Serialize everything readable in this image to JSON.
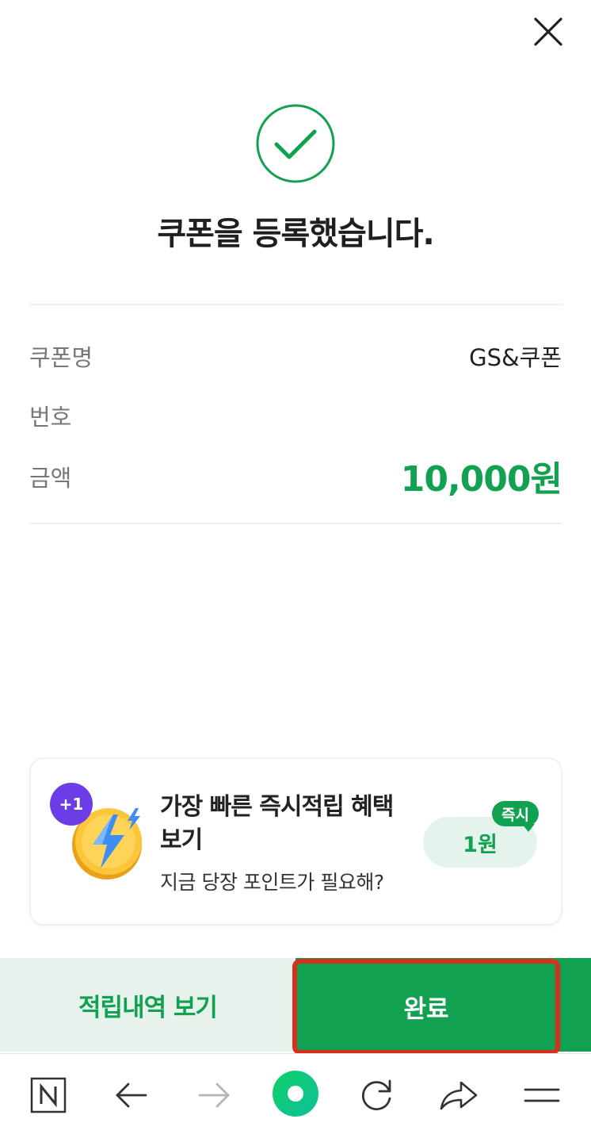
{
  "dialog": {
    "headline": "쿠폰을 등록했습니다."
  },
  "details": {
    "coupon_name_label": "쿠폰명",
    "coupon_name_value": "GS&쿠폰",
    "number_label": "번호",
    "number_value": "",
    "amount_label": "금액",
    "amount_value": "10,000원"
  },
  "promo": {
    "badge": "+1",
    "title": "가장 빠른 즉시적립 혜택 보기",
    "subtitle": "지금 당장 포인트가 필요해?",
    "reward": "1원",
    "instant_label": "즉시"
  },
  "actions": {
    "history_label": "적립내역 보기",
    "done_label": "완료"
  },
  "colors": {
    "accent": "#12a150",
    "highlight_border": "#d6311c",
    "promo_badge": "#6c3ce6"
  },
  "icons": {
    "close": "close-icon",
    "success": "check-circle-icon",
    "coin": "lightning-coin-icon",
    "nav": [
      "naver-n-icon",
      "back-arrow-icon",
      "forward-arrow-icon",
      "home-dot-icon",
      "refresh-icon",
      "share-icon",
      "menu-icon"
    ]
  }
}
